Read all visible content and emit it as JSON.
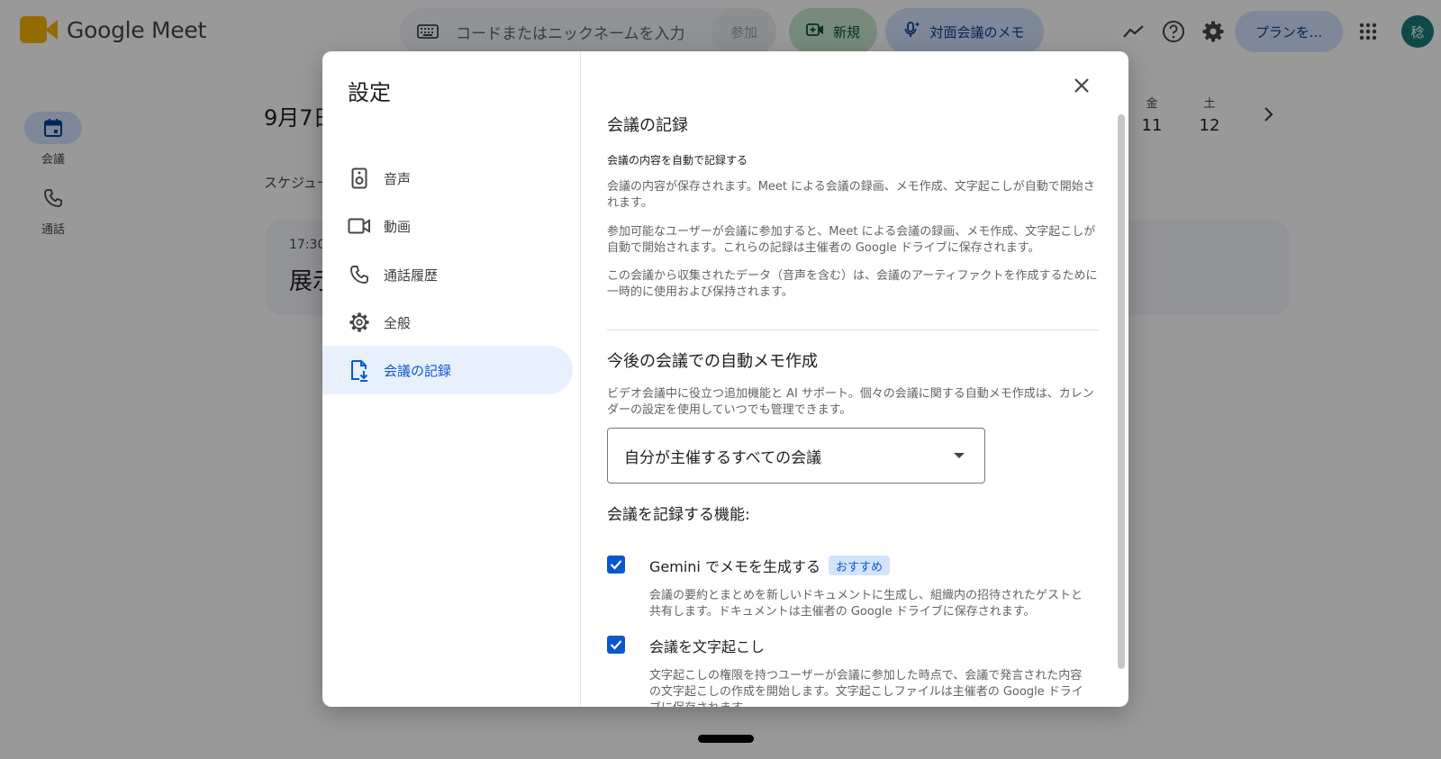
{
  "app": {
    "logo_google": "Google",
    "logo_meet": "Meet",
    "search_placeholder": "コードまたはニックネームを入力",
    "join_label": "参加",
    "new_label": "新規",
    "memo_label": "対面会議のメモ",
    "plan_label": "プランを...",
    "avatar_initial": "稔"
  },
  "nav": {
    "meetings": "会議",
    "calls": "通話"
  },
  "background": {
    "date_fragment": "9月7日",
    "schedule_fragment": "スケジュー",
    "card_time": "17:30",
    "card_title_fragment": "展示",
    "weekdays": [
      {
        "day": "金",
        "date": "11"
      },
      {
        "day": "土",
        "date": "12"
      }
    ]
  },
  "dialog": {
    "title": "設定",
    "menu": [
      {
        "label": "音声",
        "icon": "speaker-icon"
      },
      {
        "label": "動画",
        "icon": "videocam-icon"
      },
      {
        "label": "通話履歴",
        "icon": "phone-icon"
      },
      {
        "label": "全般",
        "icon": "gear-icon"
      },
      {
        "label": "会議の記録",
        "icon": "file-download-icon",
        "active": true
      }
    ],
    "section1": {
      "heading": "会議の記録",
      "subheading": "会議の内容を自動で記録する",
      "para1": "会議の内容が保存されます。Meet による会議の録画、メモ作成、文字起こしが自動で開始されます。",
      "para2": "参加可能なユーザーが会議に参加すると、Meet による会議の録画、メモ作成、文字起こしが自動で開始されます。これらの記録は主催者の Google ドライブに保存されます。",
      "para3": "この会議から収集されたデータ（音声を含む）は、会議のアーティファクトを作成するために一時的に使用および保持されます。"
    },
    "section2": {
      "heading": "今後の会議での自動メモ作成",
      "para": "ビデオ会議中に役立つ追加機能と AI サポート。個々の会議に関する自動メモ作成は、カレンダーの設定を使用していつでも管理できます。",
      "select_value": "自分が主催するすべての会議",
      "features_heading": "会議を記録する機能:"
    },
    "features": [
      {
        "label": "Gemini でメモを生成する",
        "badge": "おすすめ",
        "checked": true,
        "description": "会議の要約とまとめを新しいドキュメントに生成し、組織内の招待されたゲストと共有します。ドキュメントは主催者の Google ドライブに保存されます。"
      },
      {
        "label": "会議を文字起こし",
        "checked": true,
        "description": "文字起こしの権限を持つユーザーが会議に参加した時点で、会議で発言された内容の文字起こしの作成を開始します。文字起こしファイルは主催者の Google ドライブに保存されます。"
      }
    ]
  },
  "colors": {
    "accent": "#0b57d0",
    "active_menu_bg": "#e8f0fe",
    "new_pill_bg": "#c7e8cf",
    "memo_pill_bg": "#d3e3fd"
  }
}
